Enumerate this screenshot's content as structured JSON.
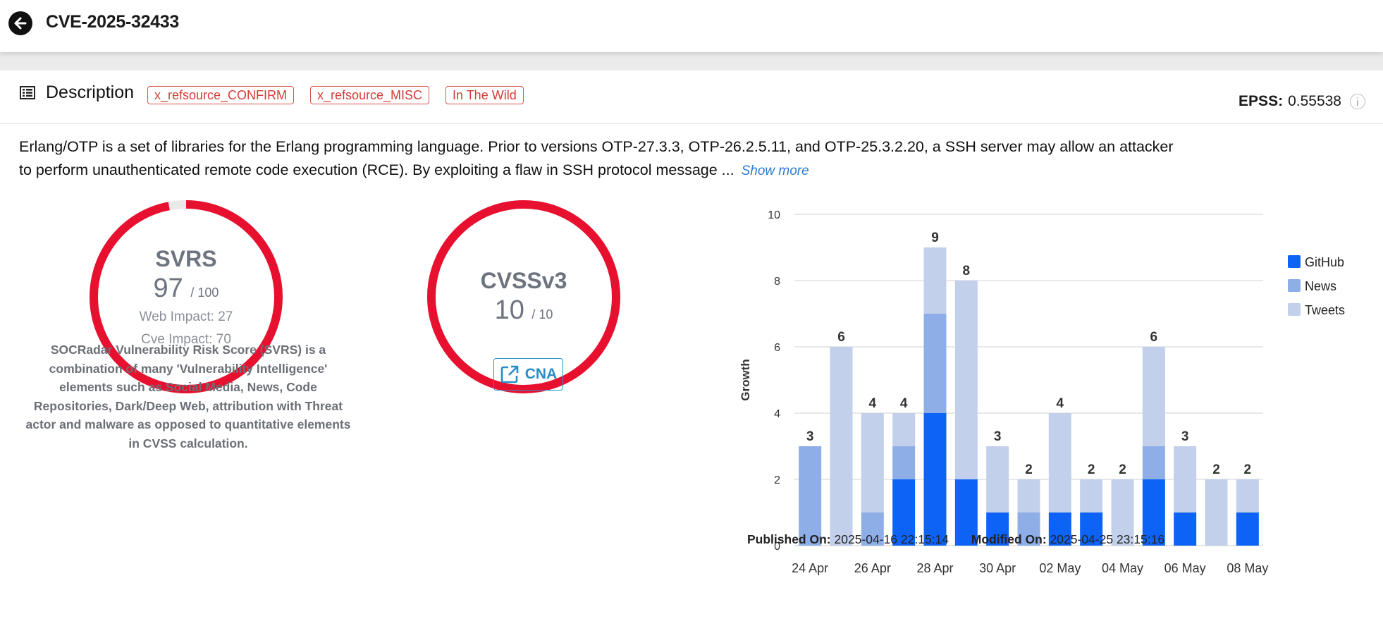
{
  "header": {
    "title": "CVE-2025-32433"
  },
  "card": {
    "section_label": "Description",
    "tags": [
      "x_refsource_CONFIRM",
      "x_refsource_MISC",
      "In The Wild"
    ],
    "epss_label": "EPSS:",
    "epss_value": "0.55538",
    "description": "Erlang/OTP is a set of libraries for the Erlang programming language. Prior to versions OTP-27.3.3, OTP-26.2.5.11, and OTP-25.3.2.20, a SSH server may allow an attacker to perform unauthenticated remote code execution (RCE). By exploiting a flaw in SSH protocol message ...",
    "show_more": "Show more"
  },
  "svrs": {
    "name": "SVRS",
    "score": "97",
    "max": "/ 100",
    "score_value": 97,
    "web_impact": "Web Impact: 27",
    "cve_impact": "Cve Impact: 70",
    "color": "#e8102f",
    "explanation": "SOCRadar Vulnerability Risk Score (SVRS) is a combination of many 'Vulnerability Intelligence' elements such as Social Media, News, Code Repositories, Dark/Deep Web, attribution with Threat actor and malware as opposed to quantitative elements in CVSS calculation."
  },
  "cvss": {
    "name": "CVSSv3",
    "score": "10",
    "max": "/ 10",
    "score_value": 10,
    "color": "#e8102f"
  },
  "cna_button": "CNA",
  "dates": {
    "published_label": "Published On:",
    "published_value": "2025-04-16 22:15:14",
    "modified_label": "Modified On:",
    "modified_value": "2025-04-25 23:15:16"
  },
  "chart_data": {
    "type": "bar",
    "stacked": true,
    "ylabel": "Growth",
    "ylim": [
      0,
      10
    ],
    "yticks": [
      0,
      2,
      4,
      6,
      8,
      10
    ],
    "categories": [
      "24 Apr",
      "25 Apr",
      "26 Apr",
      "27 Apr",
      "28 Apr",
      "29 Apr",
      "30 Apr",
      "01 May",
      "02 May",
      "03 May",
      "04 May",
      "05 May",
      "06 May",
      "07 May",
      "08 May"
    ],
    "xtick_labels": [
      "24 Apr",
      "26 Apr",
      "28 Apr",
      "30 Apr",
      "02 May",
      "04 May",
      "06 May",
      "08 May"
    ],
    "series": [
      {
        "name": "GitHub",
        "color": "#0d63f5",
        "values": [
          0,
          0,
          0,
          2,
          4,
          2,
          1,
          0,
          1,
          1,
          0,
          2,
          1,
          0,
          1
        ]
      },
      {
        "name": "News",
        "color": "#8eaee8",
        "values": [
          3,
          0,
          1,
          1,
          3,
          0,
          0,
          1,
          0,
          0,
          0,
          1,
          0,
          0,
          0
        ]
      },
      {
        "name": "Tweets",
        "color": "#c3d0ec",
        "values": [
          0,
          6,
          3,
          1,
          2,
          6,
          2,
          1,
          3,
          1,
          2,
          3,
          2,
          2,
          1
        ]
      }
    ],
    "totals": [
      3,
      6,
      4,
      4,
      9,
      8,
      3,
      2,
      4,
      2,
      2,
      6,
      3,
      2,
      2
    ],
    "legend_position": "right",
    "grid": true
  }
}
